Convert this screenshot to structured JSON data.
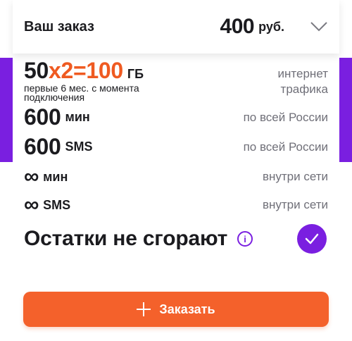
{
  "header": {
    "title": "Ваш заказ",
    "price": "400",
    "currency": "руб.",
    "chevron_icon": "chevron-down-icon"
  },
  "traffic": {
    "base": "50",
    "multiplier": "x2=",
    "total": "100",
    "unit": "ГБ",
    "note_line1": "первые 6 мес. с момента",
    "note_line2": "подключения",
    "right_line1": "интернет",
    "right_line2": "трафика"
  },
  "minutes": {
    "value": "600",
    "unit": "мин",
    "scope": "по всей России"
  },
  "sms": {
    "value": "600",
    "unit": "SMS",
    "scope": "по всей России"
  },
  "unlimited_minutes": {
    "value": "∞",
    "unit": "мин",
    "scope": "внутри сети"
  },
  "unlimited_sms": {
    "value": "∞",
    "unit": "SMS",
    "scope": "внутри сети"
  },
  "remains": {
    "label": "Остатки не сгорают",
    "info_icon": "info-icon",
    "check_icon": "check-icon",
    "checked": true
  },
  "order_button": {
    "label": "Заказать",
    "icon": "plus-icon"
  },
  "colors": {
    "accent": "#7a1fe0",
    "button": "#f4612b",
    "highlight": "#ef5a21"
  }
}
